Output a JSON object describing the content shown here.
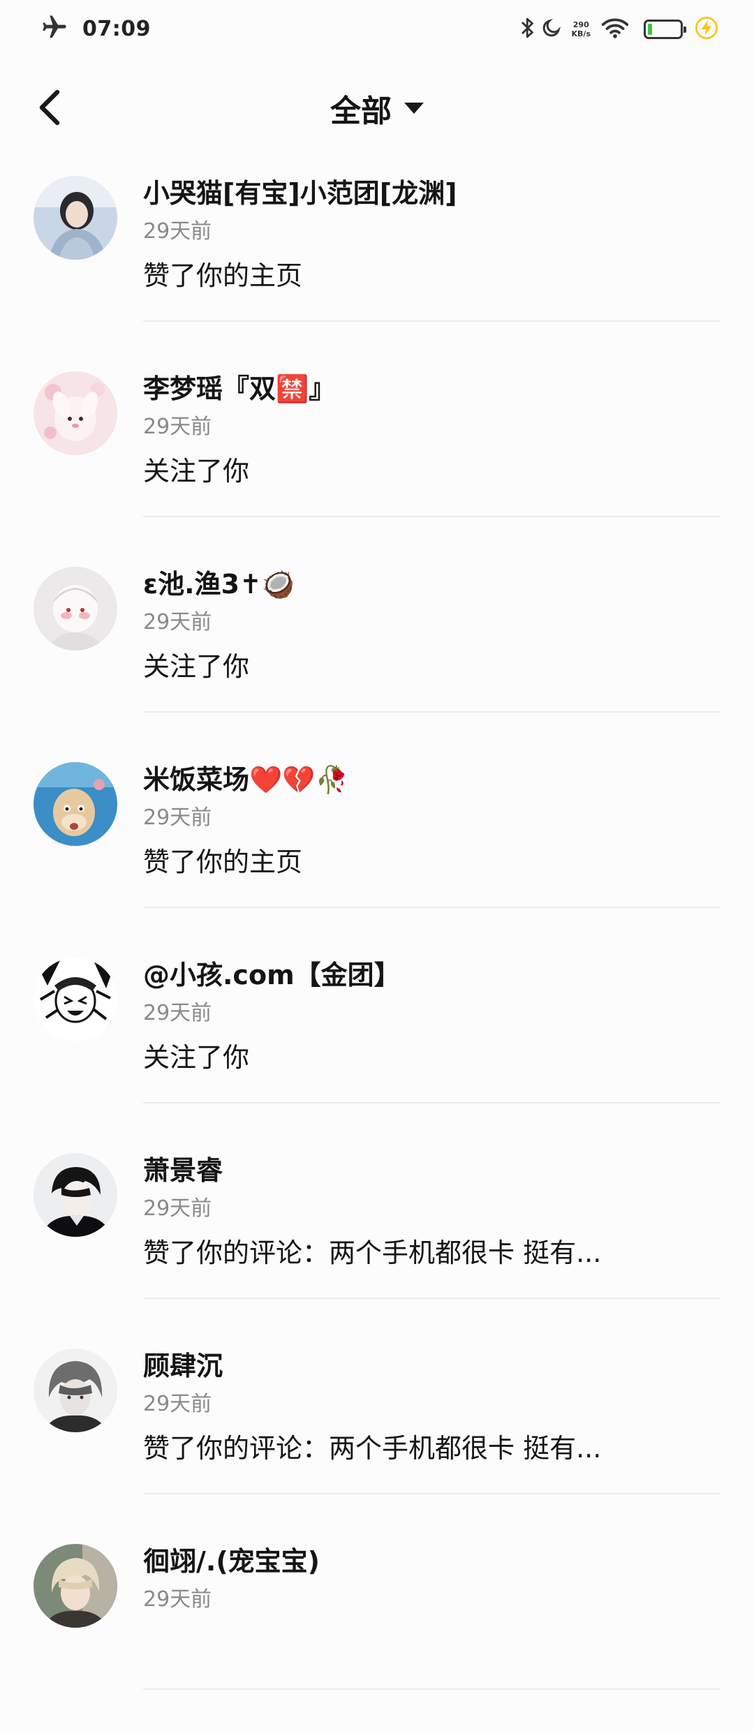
{
  "status_bar": {
    "time": "07:09",
    "net_speed_value": "290",
    "net_speed_unit": "KB/s",
    "battery_level": 0.12,
    "icons": [
      "airplane-icon",
      "bluetooth-icon",
      "moon-icon",
      "wifi-icon",
      "battery-icon",
      "charging-icon"
    ]
  },
  "header": {
    "filter_label": "全部"
  },
  "notifications": [
    {
      "name": "小哭猫[有宝]小范团[龙渊]",
      "time": "29天前",
      "action": "赞了你的主页"
    },
    {
      "name": "李梦瑶『双🈲』",
      "time": "29天前",
      "action": "关注了你"
    },
    {
      "name": "ε池.渔3✝🥥",
      "time": "29天前",
      "action": "关注了你"
    },
    {
      "name": "米饭菜场❤️💔🥀",
      "time": "29天前",
      "action": "赞了你的主页"
    },
    {
      "name": "@小孩.com【金团】",
      "time": "29天前",
      "action": "关注了你"
    },
    {
      "name": "萧景睿",
      "time": "29天前",
      "action": "赞了你的评论：两个手机都很卡 挺有..."
    },
    {
      "name": "顾肆沉",
      "time": "29天前",
      "action": "赞了你的评论：两个手机都很卡 挺有..."
    },
    {
      "name": "徊翊/.(宠宝宝)",
      "time": "29天前",
      "action": ""
    }
  ],
  "colors": {
    "background": "#fdfcfd",
    "text_primary": "#151515",
    "text_secondary": "#8a8a8a",
    "divider": "#ececec",
    "battery_green": "#3fc33f",
    "charge_yellow": "#f5c518"
  }
}
